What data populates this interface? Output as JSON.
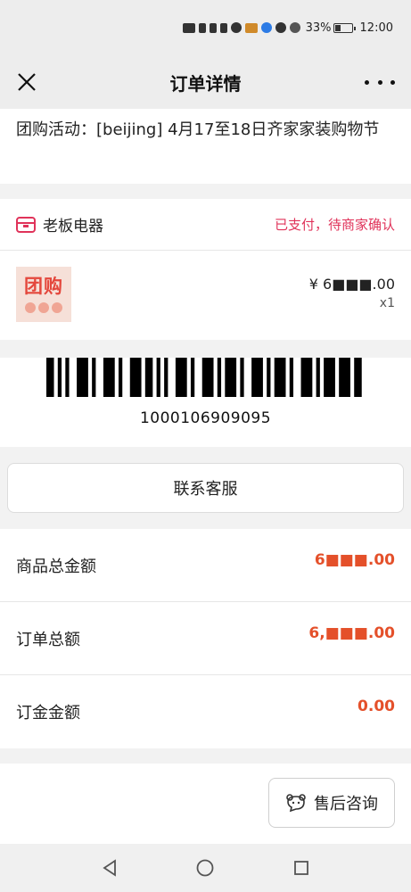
{
  "status_bar": {
    "battery": "33%",
    "time": "12:00",
    "icons": [
      "hd-icon",
      "signal-4g-icon",
      "signal-4g-icon",
      "wifi-icon",
      "wechat-icon",
      "app-icon",
      "app-icon",
      "nfc-icon",
      "eye-icon",
      "battery-icon"
    ]
  },
  "header": {
    "title": "订单详情",
    "close_icon": "close-icon",
    "more_icon": "more-icon"
  },
  "activity": {
    "text": "团购活动：[beijing] 4月17至18日齐家家装购物节"
  },
  "shop": {
    "name": "老板电器",
    "status": "已支付，待商家确认",
    "icon": "shop-icon",
    "accent": "#e0335a"
  },
  "product": {
    "thumb_text": "团购",
    "price": "¥ 6■■■.00",
    "qty": "x1"
  },
  "barcode": {
    "number": "1000106909095"
  },
  "customer_service": {
    "label": "联系客服"
  },
  "summary": {
    "items": [
      {
        "label": "商品总金额",
        "value": "6■■■.00"
      },
      {
        "label": "订单总额",
        "value": "6,■■■.00"
      },
      {
        "label": "订金金额",
        "value": "0.00"
      }
    ],
    "value_color": "#e4502a"
  },
  "footer": {
    "after_sale_label": "售后咨询",
    "after_sale_icon": "chat-bear-icon"
  },
  "system_nav": {
    "back_icon": "back-triangle-icon",
    "home_icon": "home-circle-icon",
    "recent_icon": "recent-square-icon"
  }
}
